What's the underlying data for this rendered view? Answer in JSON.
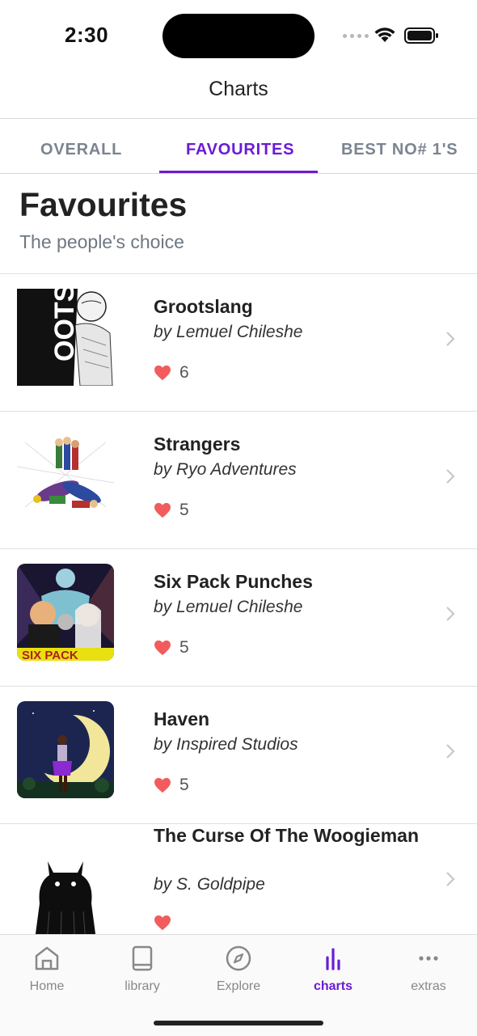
{
  "status": {
    "time": "2:30"
  },
  "nav": {
    "title": "Charts"
  },
  "tabs": [
    {
      "label": "OVERALL",
      "active": false
    },
    {
      "label": "FAVOURITES",
      "active": true
    },
    {
      "label": "BEST NO# 1'S",
      "active": false
    }
  ],
  "section": {
    "title": "Favourites",
    "subtitle": "The people's choice"
  },
  "comics": [
    {
      "title": "Grootslang",
      "author": "by Lemuel Chileshe",
      "likes": "6"
    },
    {
      "title": "Strangers",
      "author": "by Ryo Adventures",
      "likes": "5"
    },
    {
      "title": "Six Pack Punches",
      "author": "by Lemuel Chileshe",
      "likes": "5"
    },
    {
      "title": "Haven",
      "author": "by Inspired Studios",
      "likes": "5"
    },
    {
      "title": "The Curse Of The Woogieman",
      "author": "by S. Goldpipe",
      "likes": ""
    }
  ],
  "tabbar": [
    {
      "label": "Home",
      "icon": "home-icon"
    },
    {
      "label": "library",
      "icon": "book-icon"
    },
    {
      "label": "Explore",
      "icon": "compass-icon"
    },
    {
      "label": "charts",
      "icon": "bar-chart-icon",
      "active": true
    },
    {
      "label": "extras",
      "icon": "more-icon"
    }
  ],
  "colors": {
    "accent": "#6a1bd6",
    "heart": "#f25c5c",
    "text": "#222222",
    "muted": "#7b8490"
  }
}
